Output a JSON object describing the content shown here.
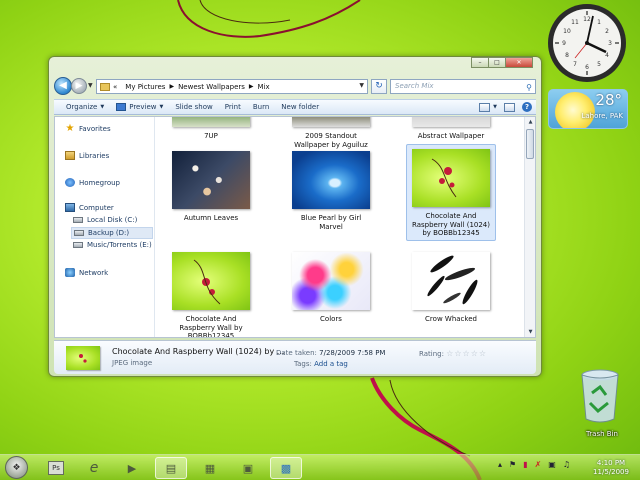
{
  "desktop": {
    "weather": {
      "temperature": "28°",
      "location": "Lahore, PAK"
    },
    "recycle_bin_label": "Trash Bin"
  },
  "window": {
    "address": {
      "parts": [
        "My Pictures",
        "Newest Wallpapers",
        "Mix"
      ]
    },
    "search_placeholder": "Search Mix",
    "toolbar": {
      "organize": "Organize",
      "preview": "Preview",
      "slideshow": "Slide show",
      "print": "Print",
      "burn": "Burn",
      "new_folder": "New folder"
    },
    "nav": {
      "favorites": "Favorites",
      "libraries": "Libraries",
      "homegroup": "Homegroup",
      "computer": "Computer",
      "local_disk": "Local Disk (C:)",
      "backup": "Backup (D:)",
      "music": "Music/Torrents (E:)",
      "network": "Network"
    },
    "files": [
      {
        "name": "7UP"
      },
      {
        "name": "2009 Standout Wallpaper by Aguiluz"
      },
      {
        "name": "Abstract Wallpaper"
      },
      {
        "name": "Autumn Leaves"
      },
      {
        "name": "Blue Pearl by Girl Marvel"
      },
      {
        "name": "Chocolate And Raspberry Wall (1024) by BOBBb12345"
      },
      {
        "name": "Chocolate And Raspberry Wall by BOBBb12345"
      },
      {
        "name": "Colors"
      },
      {
        "name": "Crow Whacked"
      }
    ],
    "details": {
      "name": "Chocolate And Raspberry Wall (1024) by ...",
      "type": "JPEG image",
      "date_label": "Date taken:",
      "date_value": "7/28/2009 7:58 PM",
      "tags_label": "Tags:",
      "tags_value": "Add a tag",
      "rating_label": "Rating:",
      "rating": 0
    }
  },
  "taskbar": {
    "time": "4:10 PM",
    "date": "11/5/2009",
    "ps_label": "Ps"
  }
}
